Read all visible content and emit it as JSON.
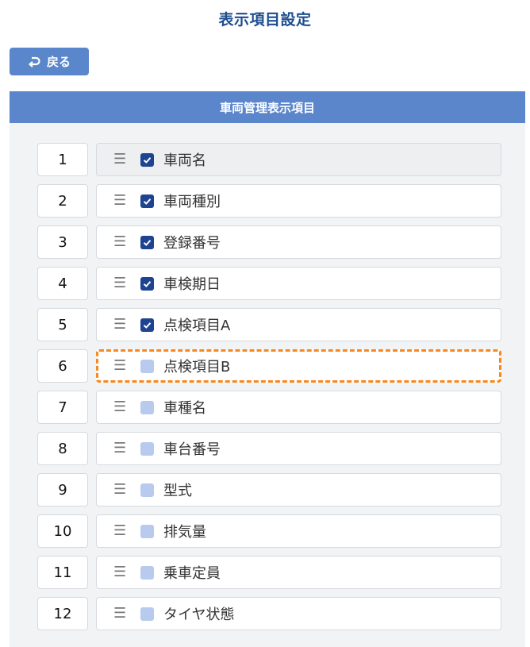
{
  "title": "表示項目設定",
  "back_label": "戻る",
  "panel_header": "車両管理表示項目",
  "items": [
    {
      "num": "1",
      "label": "車両名",
      "checked": true,
      "state": "disabled"
    },
    {
      "num": "2",
      "label": "車両種別",
      "checked": true,
      "state": "normal"
    },
    {
      "num": "3",
      "label": "登録番号",
      "checked": true,
      "state": "normal"
    },
    {
      "num": "4",
      "label": "車検期日",
      "checked": true,
      "state": "normal"
    },
    {
      "num": "5",
      "label": "点検項目A",
      "checked": true,
      "state": "normal"
    },
    {
      "num": "6",
      "label": "点検項目B",
      "checked": false,
      "state": "highlight"
    },
    {
      "num": "7",
      "label": "車種名",
      "checked": false,
      "state": "normal"
    },
    {
      "num": "8",
      "label": "車台番号",
      "checked": false,
      "state": "normal"
    },
    {
      "num": "9",
      "label": "型式",
      "checked": false,
      "state": "normal"
    },
    {
      "num": "10",
      "label": "排気量",
      "checked": false,
      "state": "normal"
    },
    {
      "num": "11",
      "label": "乗車定員",
      "checked": false,
      "state": "normal"
    },
    {
      "num": "12",
      "label": "タイヤ状態",
      "checked": false,
      "state": "normal"
    }
  ],
  "colors": {
    "title": "#1e4d8f",
    "header": "#5b86cc",
    "checked": "#1e4391",
    "unchecked": "#b8cbee",
    "highlight_border": "#f5891f"
  },
  "icons": {
    "back": "return-arrow-icon",
    "handle": "drag-handle-icon",
    "check": "checkmark-icon"
  }
}
